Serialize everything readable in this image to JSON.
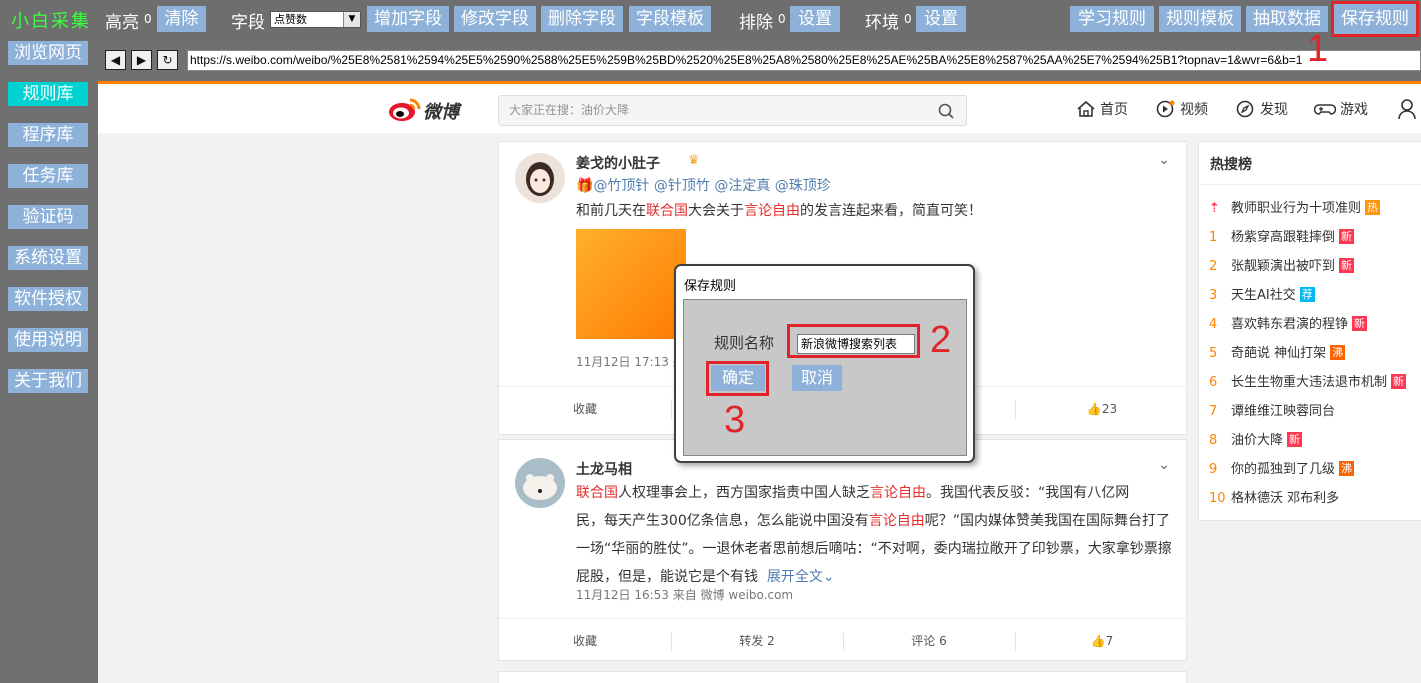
{
  "toolbar": {
    "brand": "小白采集",
    "highlight_label": "高亮",
    "highlight_count": "0",
    "clear_button": "清除",
    "field_label": "字段",
    "field_select_value": "点赞数",
    "add_field": "增加字段",
    "edit_field": "修改字段",
    "delete_field": "删除字段",
    "field_template": "字段模板",
    "exclude_label": "排除",
    "exclude_count": "0",
    "exclude_settings": "设置",
    "env_label": "环境",
    "env_count": "0",
    "env_settings": "设置",
    "learn_rule": "学习规则",
    "rule_template": "规则模板",
    "extract_data": "抽取数据",
    "save_rule": "保存规则"
  },
  "sidebar": {
    "items": [
      {
        "label": "浏览网页",
        "active": false
      },
      {
        "label": "规则库",
        "active": true
      },
      {
        "label": "程序库",
        "active": false
      },
      {
        "label": "任务库",
        "active": false
      },
      {
        "label": "验证码",
        "active": false
      },
      {
        "label": "系统设置",
        "active": false
      },
      {
        "label": "软件授权",
        "active": false
      },
      {
        "label": "使用说明",
        "active": false
      },
      {
        "label": "关于我们",
        "active": false
      }
    ]
  },
  "address_bar": {
    "back": "◀",
    "forward": "▶",
    "refresh": "↻",
    "url": "https://s.weibo.com/weibo/%25E8%2581%2594%25E5%2590%2588%25E5%259B%25BD%2520%25E8%25A8%2580%25E8%25AE%25BA%25E8%2587%25AA%25E7%2594%25B1?topnav=1&wvr=6&b=1"
  },
  "weibo": {
    "logo_text": "微博",
    "search_placeholder": "大家正在搜：油价大降",
    "nav": {
      "home": "首页",
      "video": "视频",
      "discover": "发现",
      "game": "游戏"
    },
    "posts": [
      {
        "author": "姜戈的小肚子",
        "mentions": "@竹顶针 @针顶竹 @注定真 @珠顶珍",
        "text_a": "和前几天在",
        "text_hl1": "联合国",
        "text_b": "大会关于",
        "text_hl2": "言论自由",
        "text_c": "的发言连起来看，简直可笑！",
        "meta": "11月12日 17:13 来",
        "collect": "收藏",
        "likes": "23"
      },
      {
        "author": "土龙马相",
        "line1_hl": "联合国",
        "line1_a": "人权理事会上，西方国家指责中国人缺乏",
        "line1_hl2": "言论自由",
        "line1_b": "。我国代表反驳：“我国有八亿网",
        "line2_a": "民，每天产生300亿条信息，怎么能说中国没有",
        "line2_hl": "言论自由",
        "line2_b": "呢？”国内媒体赞美我国在国际舞台打了",
        "line3": "一场“华丽的胜仗”。一退休老者思前想后嘀咕：“不对啊，委内瑞拉敞开了印钞票，大家拿钞票擦",
        "line4": "屁股，但是，能说它是个有钱",
        "expand": "展开全文",
        "meta": "11月12日 16:53 来自 微博 weibo.com",
        "collect": "收藏",
        "repost": "转发 2",
        "comment": "评论 6",
        "likes": "7"
      }
    ],
    "hot": {
      "title": "热搜榜",
      "items": [
        {
          "rank": "",
          "text": "教师职业行为十项准则",
          "badge": "热",
          "badge_color": "#ff9406"
        },
        {
          "rank": "1",
          "text": "杨紫穿高跟鞋摔倒",
          "badge": "新",
          "badge_color": "#ff3852"
        },
        {
          "rank": "2",
          "text": "张靓颖演出被吓到",
          "badge": "新",
          "badge_color": "#ff3852"
        },
        {
          "rank": "3",
          "text": "天生AI社交",
          "badge": "荐",
          "badge_color": "#00b7ee"
        },
        {
          "rank": "4",
          "text": "喜欢韩东君演的程铮",
          "badge": "新",
          "badge_color": "#ff3852"
        },
        {
          "rank": "5",
          "text": "奇葩说 神仙打架",
          "badge": "沸",
          "badge_color": "#f86400"
        },
        {
          "rank": "6",
          "text": "长生生物重大违法退市机制",
          "badge": "新",
          "badge_color": "#ff3852"
        },
        {
          "rank": "7",
          "text": "谭维维江映蓉同台",
          "badge": "",
          "badge_color": ""
        },
        {
          "rank": "8",
          "text": "油价大降",
          "badge": "新",
          "badge_color": "#ff3852"
        },
        {
          "rank": "9",
          "text": "你的孤独到了几级",
          "badge": "沸",
          "badge_color": "#f86400"
        },
        {
          "rank": "10",
          "text": "格林德沃 邓布利多",
          "badge": "",
          "badge_color": ""
        }
      ]
    }
  },
  "dialog": {
    "title": "保存规则",
    "name_label": "规则名称",
    "name_value": "新浪微博搜索列表",
    "ok": "确定",
    "cancel": "取消"
  },
  "annotations": {
    "step1": "1",
    "step2": "2",
    "step3": "3"
  },
  "colors": {
    "toolbar_bg": "#6e6e6e",
    "button_bg": "#8db1d9",
    "active_sidebar": "#00d2d2",
    "brand": "#39ff3c",
    "highlight_red": "#e0242a",
    "weibo_orange": "#ff8200"
  }
}
